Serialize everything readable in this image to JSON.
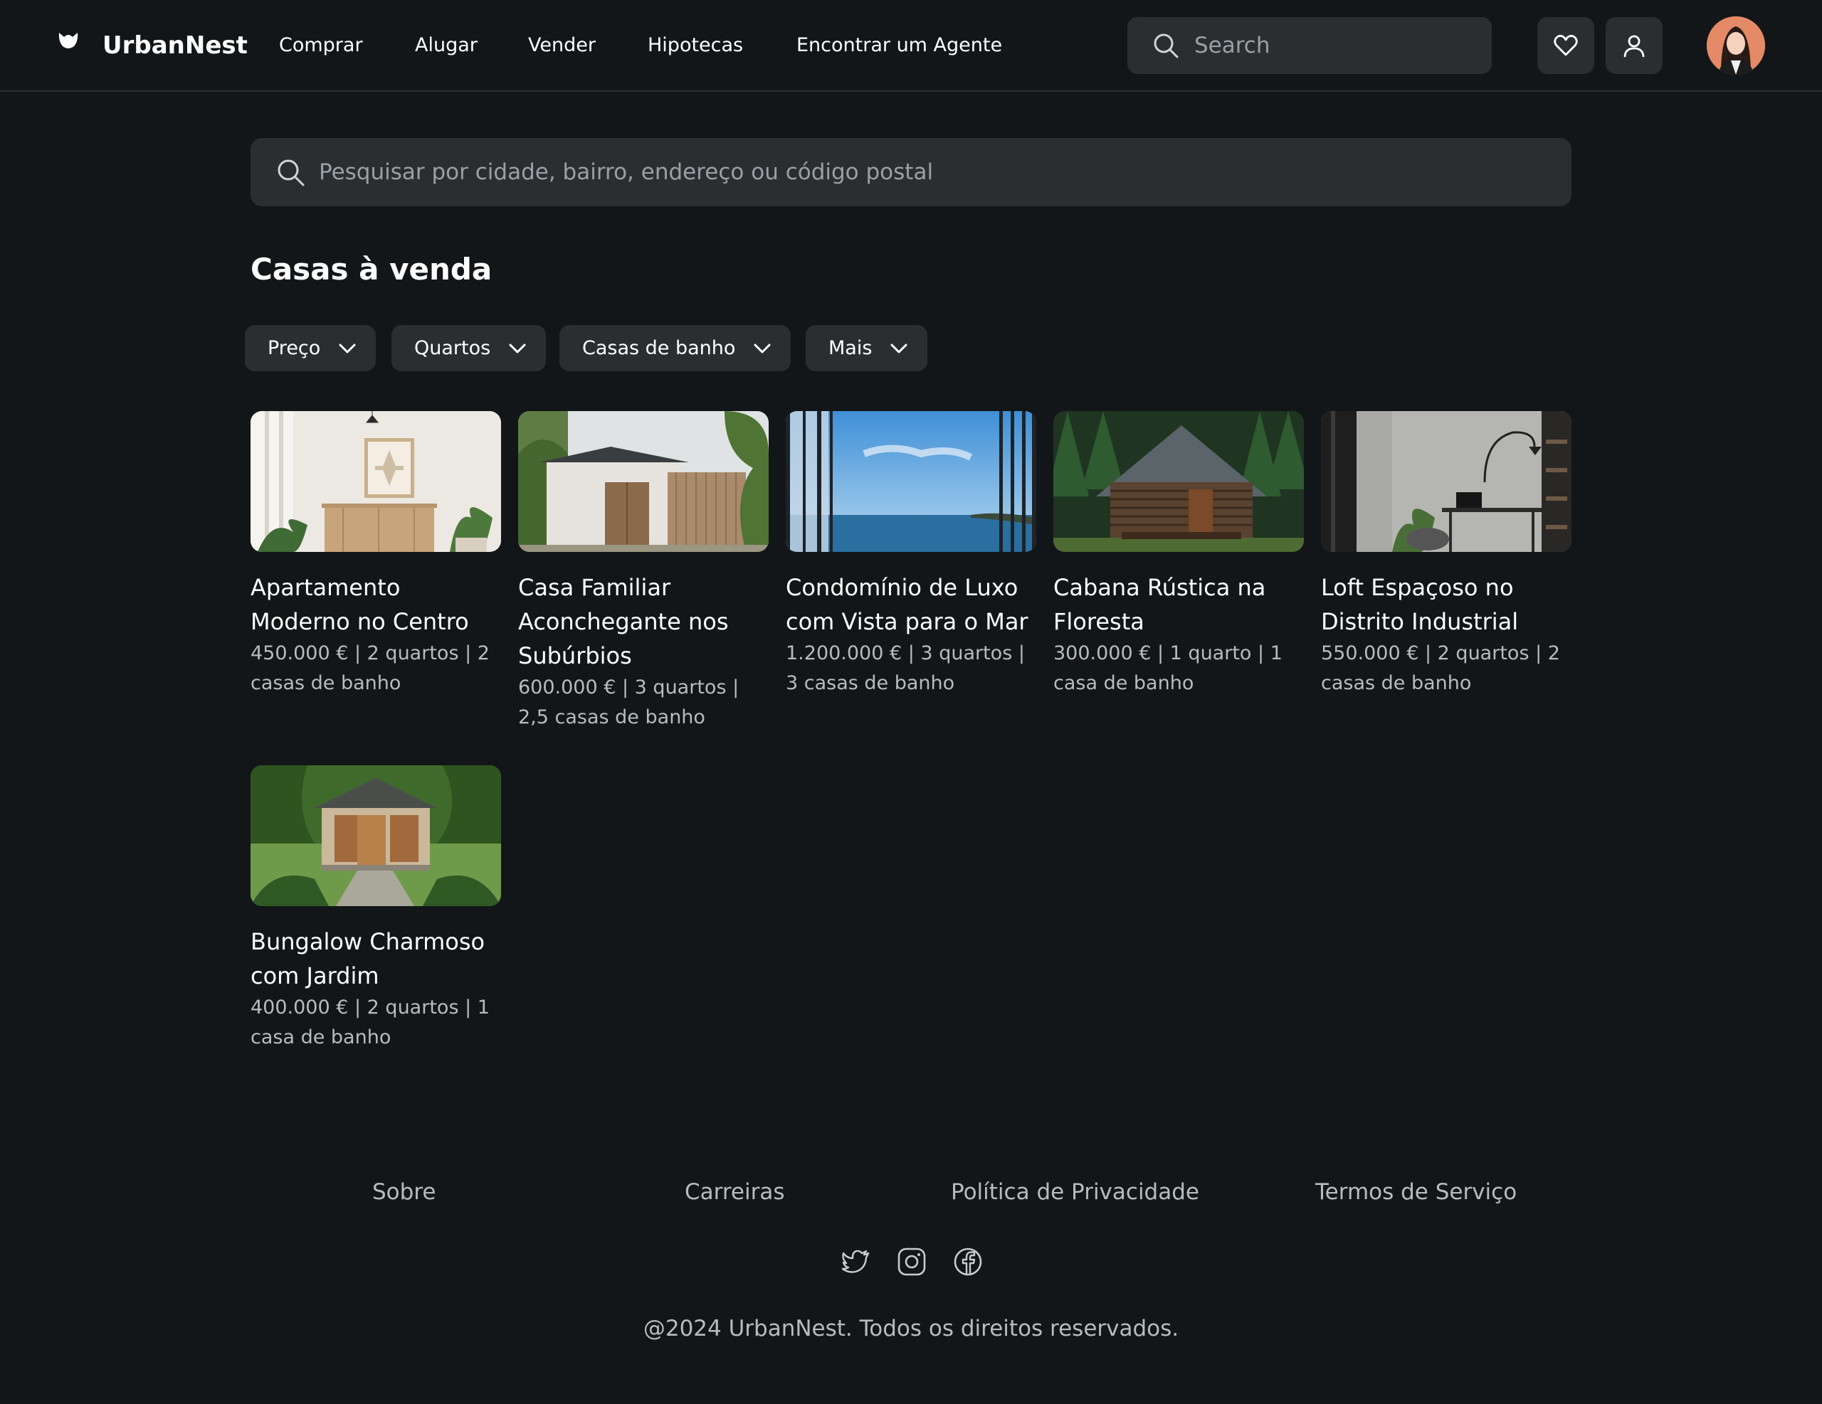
{
  "header": {
    "brand": "UrbanNest",
    "nav": [
      {
        "label": "Comprar"
      },
      {
        "label": "Alugar"
      },
      {
        "label": "Vender"
      },
      {
        "label": "Hipotecas"
      },
      {
        "label": "Encontrar um Agente"
      }
    ],
    "search_placeholder": "Search",
    "icons": [
      "logo-icon",
      "search-icon",
      "heart-icon",
      "user-icon",
      "avatar"
    ]
  },
  "main": {
    "search_placeholder": "Pesquisar por cidade, bairro, endereço ou código postal",
    "title": "Casas à venda",
    "filters": [
      {
        "label": "Preço"
      },
      {
        "label": "Quartos"
      },
      {
        "label": "Casas de banho"
      },
      {
        "label": "Mais"
      }
    ],
    "listings": [
      {
        "title": "Apartamento Moderno no Centro",
        "meta": "450.000 € | 2 quartos | 2 casas de banho"
      },
      {
        "title": "Casa Familiar Aconchegante nos Subúrbios",
        "meta": "600.000 € | 3 quartos | 2,5 casas de banho"
      },
      {
        "title": "Condomínio de Luxo com Vista para o Mar",
        "meta": "1.200.000 € | 3 quartos | 3 casas de banho"
      },
      {
        "title": "Cabana Rústica na Floresta",
        "meta": "300.000 € | 1 quarto | 1 casa de banho"
      },
      {
        "title": "Loft Espaçoso no Distrito Industrial",
        "meta": "550.000 € | 2 quartos | 2 casas de banho"
      },
      {
        "title": "Bungalow Charmoso com Jardim",
        "meta": "400.000 € | 2 quartos | 1 casa de banho"
      }
    ]
  },
  "footer": {
    "links": [
      {
        "label": "Sobre"
      },
      {
        "label": "Carreiras"
      },
      {
        "label": "Política de Privacidade"
      },
      {
        "label": "Termos de Serviço"
      }
    ],
    "social": [
      "twitter-icon",
      "instagram-icon",
      "facebook-icon"
    ],
    "copyright": "@2024 UrbanNest. Todos os direitos reservados."
  },
  "colors": {
    "background": "#121618",
    "surface": "#2b2e31",
    "text": "#ffffff",
    "muted": "#b7bcbf"
  }
}
